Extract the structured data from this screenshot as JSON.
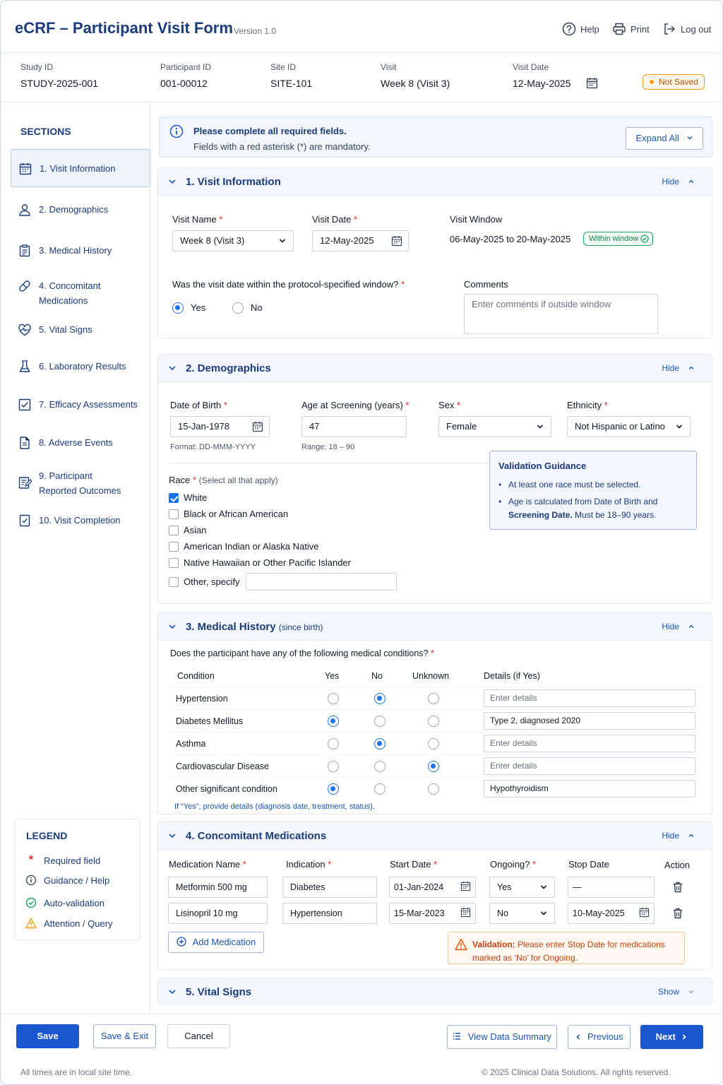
{
  "app": {
    "title": "eCRF – Participant Visit Form",
    "version": "Version 1.0",
    "actions": {
      "help": "Help",
      "print": "Print",
      "logout": "Log out"
    }
  },
  "info": {
    "study": {
      "label": "Study ID",
      "value": "STUDY-2025-001"
    },
    "participant": {
      "label": "Participant ID",
      "value": "001-00012"
    },
    "site": {
      "label": "Site ID",
      "value": "SITE-101"
    },
    "visit": {
      "label": "Visit",
      "value": "Week 8 (Visit 3)"
    },
    "visit_date": {
      "label": "Visit Date",
      "value": "12-May-2025"
    },
    "status": "Not Saved"
  },
  "sidebar": {
    "title": "SECTIONS",
    "items": [
      {
        "label": "1. Visit Information",
        "icon": "calendar-icon"
      },
      {
        "label": "2. Demographics",
        "icon": "person-icon"
      },
      {
        "label": "3. Medical History",
        "icon": "clipboard-icon"
      },
      {
        "label": "4. Concomitant\nMedications",
        "icon": "pill-icon"
      },
      {
        "label": "5. Vital Signs",
        "icon": "heartbeat-icon"
      },
      {
        "label": "6. Laboratory Results",
        "icon": "flask-icon"
      },
      {
        "label": "7. Efficacy Assessments",
        "icon": "chart-check-icon"
      },
      {
        "label": "8. Adverse Events",
        "icon": "document-icon"
      },
      {
        "label": "9. Participant\nReported Outcomes",
        "icon": "edit-form-icon"
      },
      {
        "label": "10. Visit Completion",
        "icon": "checklist-icon"
      }
    ]
  },
  "legend": {
    "title": "LEGEND",
    "items": {
      "required": {
        "symbol": "*",
        "label": "Required field"
      },
      "guidance": "Guidance / Help",
      "auto": "Auto-validation",
      "attention": "Attention / Query"
    }
  },
  "notice": {
    "line1": "Please complete all required fields.",
    "line2": "Fields with a red asterisk (*) are mandatory.",
    "expand_all": "Expand All"
  },
  "visit_info": {
    "title": "1. Visit Information",
    "toggle": "Hide",
    "visit_name_label": "Visit Name",
    "visit_name_value": "Week 8 (Visit 3)",
    "visit_date_label": "Visit Date",
    "visit_date_value": "12-May-2025",
    "window_label": "Visit Window",
    "window_value": "06-May-2025 to 20-May-2025",
    "window_badge": "Within window",
    "question": "Was the visit date within the protocol-specified window?",
    "yes": "Yes",
    "no": "No",
    "selected": "Yes",
    "comments_label": "Comments",
    "comments_placeholder": "Enter comments if outside window"
  },
  "demographics": {
    "title": "2. Demographics",
    "toggle": "Hide",
    "dob_label": "Date of Birth",
    "dob_value": "15-Jan-1978",
    "dob_hint": "Format: DD-MMM-YYYY",
    "age_label": "Age at Screening (years)",
    "age_value": "47",
    "age_hint": "Range: 18 – 90",
    "sex_label": "Sex",
    "sex_value": "Female",
    "ethnicity_label": "Ethnicity",
    "ethnicity_value": "Not Hispanic or Latino",
    "race_label": "Race",
    "race_note": "(Select all that apply)",
    "race_options": [
      {
        "label": "White",
        "checked": true
      },
      {
        "label": "Black or African American",
        "checked": false
      },
      {
        "label": "Asian",
        "checked": false
      },
      {
        "label": "American Indian or Alaska Native",
        "checked": false
      },
      {
        "label": "Native Hawaiian or Other Pacific Islander",
        "checked": false
      },
      {
        "label": "Other, specify",
        "checked": false
      }
    ],
    "guidance_title": "Validation Guidance",
    "guidance_1": "At least one race must be selected.",
    "guidance_2a": "Age is calculated from Date of Birth and ",
    "guidance_2b": "Screening Date.",
    "guidance_2c": " Must be 18–90 years."
  },
  "medical_history": {
    "title": "3. Medical History",
    "title_sub": "(since birth)",
    "toggle": "Hide",
    "question": "Does the participant have any of the following medical conditions?",
    "columns": {
      "condition": "Condition",
      "yes": "Yes",
      "no": "No",
      "unknown": "Unknown",
      "details": "Details (if Yes)"
    },
    "rows": [
      {
        "condition": "Hypertension",
        "answer": "no",
        "details": "",
        "placeholder": "Enter details"
      },
      {
        "condition": "Diabetes Mellitus",
        "answer": "yes",
        "details": "Type 2, diagnosed 2020",
        "placeholder": "Enter details"
      },
      {
        "condition": "Asthma",
        "answer": "no",
        "details": "",
        "placeholder": "Enter details"
      },
      {
        "condition": "Cardiovascular Disease",
        "answer": "unknown",
        "details": "",
        "placeholder": "Enter details"
      },
      {
        "condition": "Other significant condition",
        "answer": "yes",
        "details": "Hypothyroidism",
        "placeholder": "Enter details"
      }
    ],
    "note": "If “Yes”, provide details (diagnosis date, treatment, status)."
  },
  "con_meds": {
    "title": "4. Concomitant Medications",
    "toggle": "Hide",
    "columns": {
      "name": "Medication Name",
      "indication": "Indication",
      "start": "Start Date",
      "ongoing": "Ongoing?",
      "stop": "Stop Date",
      "action": "Action"
    },
    "rows": [
      {
        "name": "Metformin 500 mg",
        "indication": "Diabetes",
        "start": "01-Jan-2024",
        "ongoing": "Yes",
        "stop": "—"
      },
      {
        "name": "Lisinopril 10 mg",
        "indication": "Hypertension",
        "start": "15-Mar-2023",
        "ongoing": "No",
        "stop": "10-May-2025"
      }
    ],
    "add_label": "Add Medication",
    "warn_prefix": "Validation:",
    "warn_text": " Please enter Stop Date for medications marked as ‘No’ for Ongoing."
  },
  "vital_signs": {
    "title": "5. Vital Signs",
    "toggle": "Show"
  },
  "footer": {
    "save": "Save",
    "save_exit": "Save & Exit",
    "cancel": "Cancel",
    "view_summary": "View Data Summary",
    "previous": "Previous",
    "next": "Next",
    "time_note": "All times are in local site time.",
    "copyright": "© 2025 Clinical Data Solutions. All rights reserved."
  },
  "colors": {
    "brand": "#1a3a7a",
    "accent": "#1a56d0",
    "required": "#dc2626",
    "warning": "#f59e0b",
    "success": "#22a35a"
  }
}
